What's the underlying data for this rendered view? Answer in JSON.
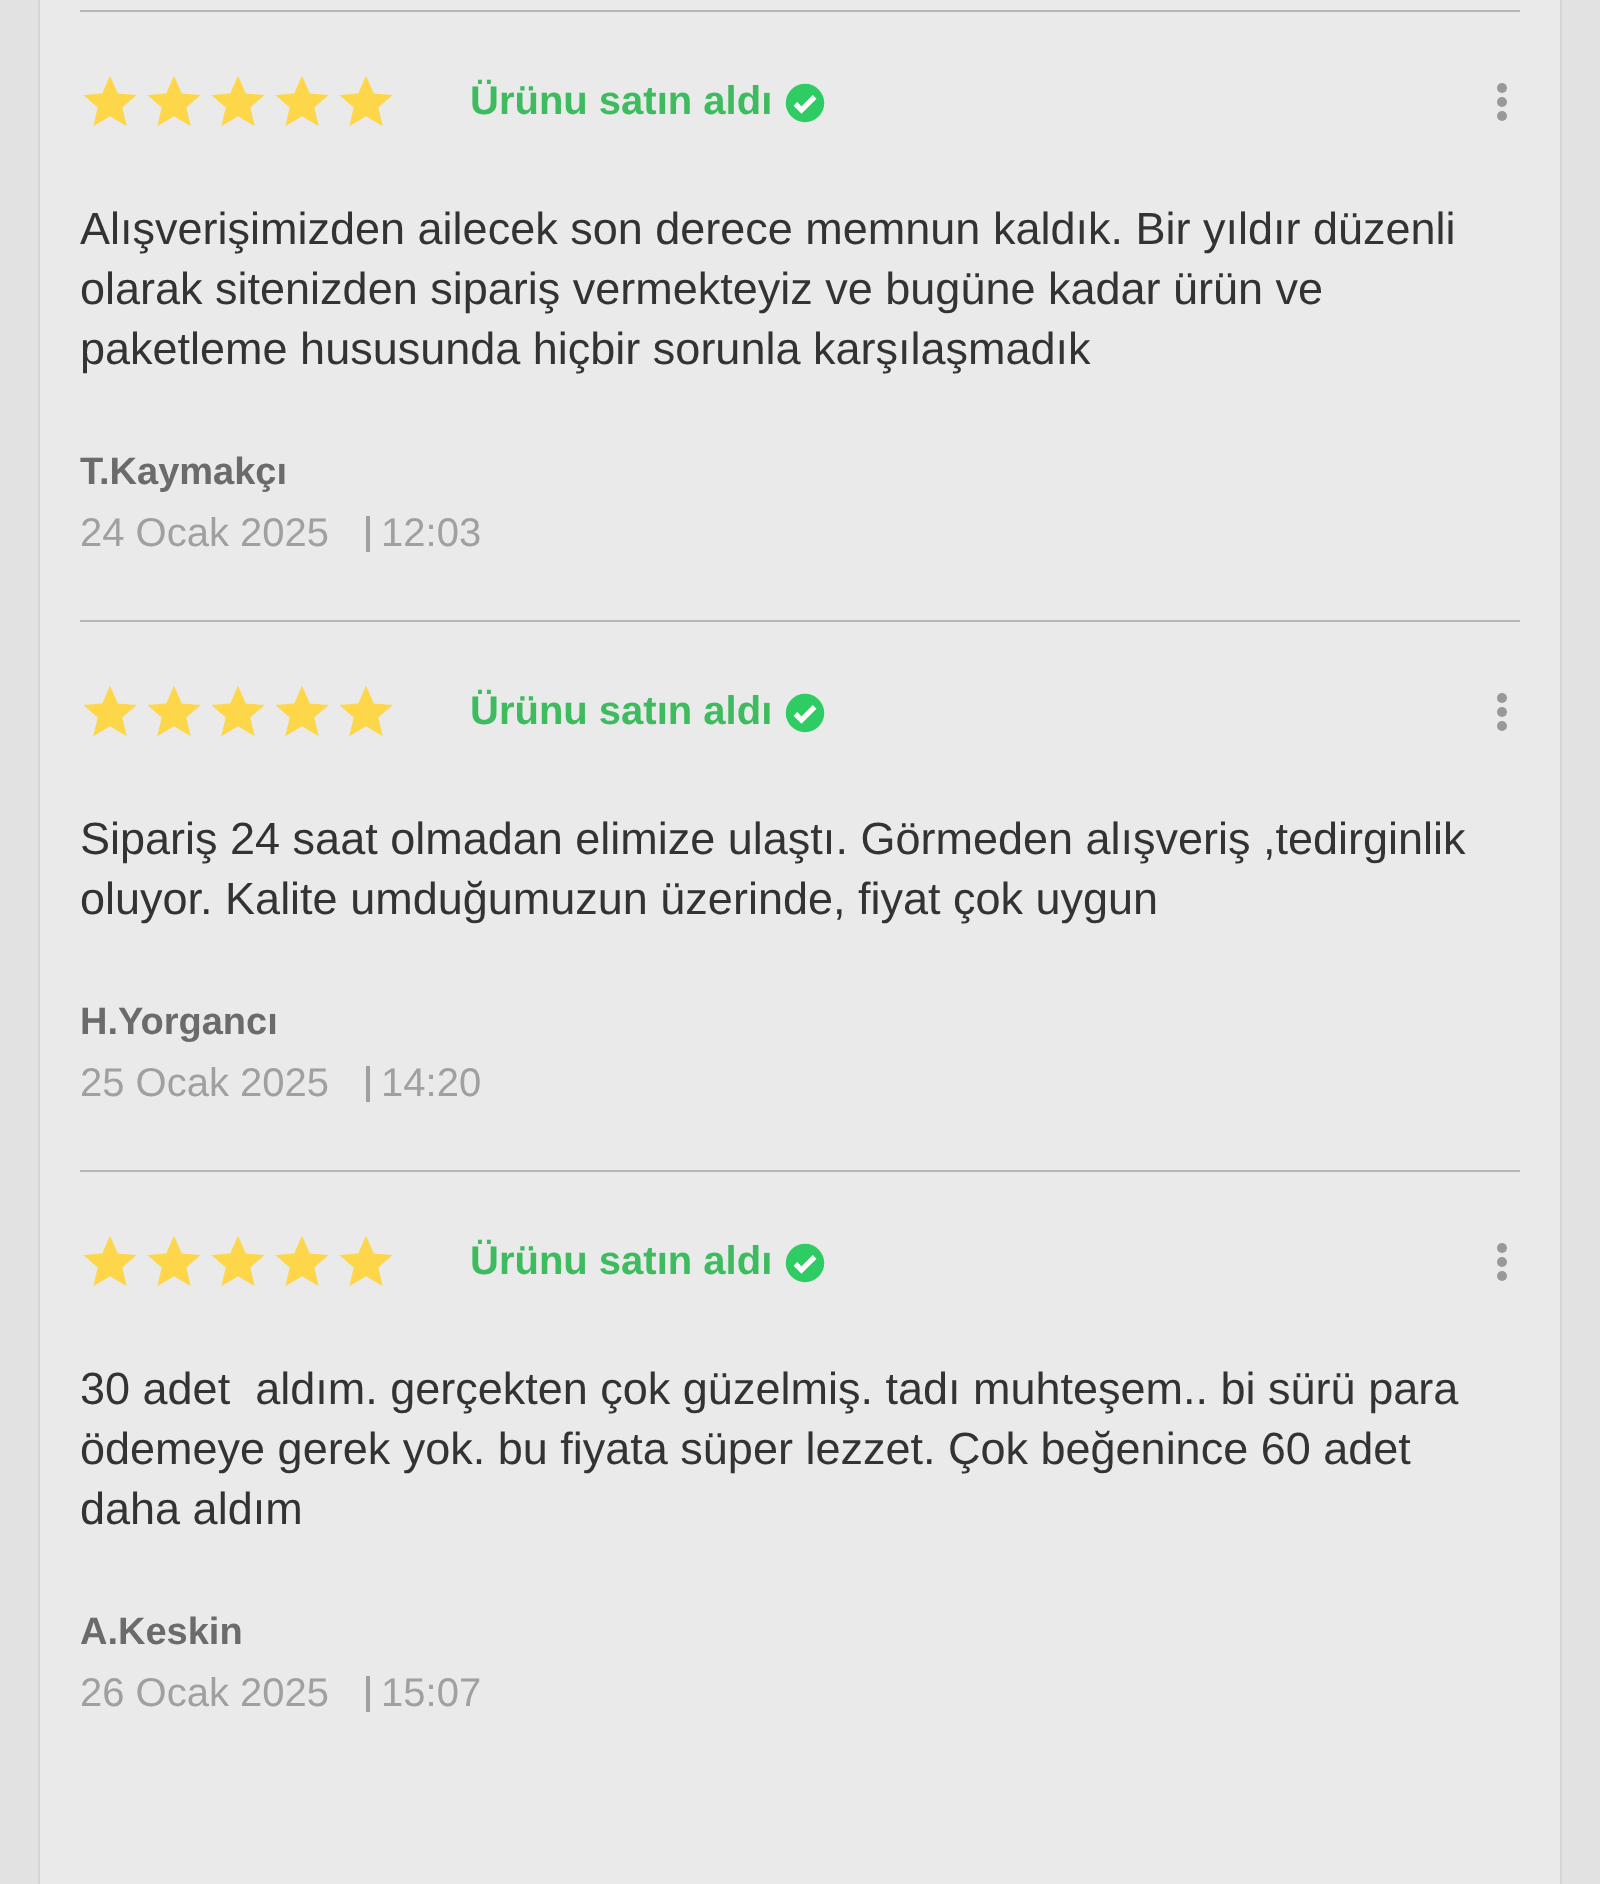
{
  "reviews": [
    {
      "stars": 5,
      "badge": "Ürünu satın aldı",
      "text": "Alışverişimizden ailecek son derece memnun kaldık. Bir yıldır düzenli olarak sitenizden sipariş vermekteyiz ve bugüne kadar ürün ve paketleme hususunda hiçbir sorunla karşılaşmadık",
      "author": "T.Kaymakçı",
      "date": "24 Ocak 2025",
      "time": "12:03"
    },
    {
      "stars": 5,
      "badge": "Ürünu satın aldı",
      "text": "Sipariş 24 saat olmadan elimize ulaştı. Görmeden alışveriş ,tedirginlik oluyor. Kalite umduğumuzun üzerinde, fiyat çok uygun",
      "author": "H.Yorgancı",
      "date": "25 Ocak 2025",
      "time": "14:20"
    },
    {
      "stars": 5,
      "badge": "Ürünu satın aldı",
      "text": "30 adet  aldım. gerçekten çok güzelmiş. tadı muhteşem.. bi sürü para ödemeye gerek yok. bu fiyata süper lezzet. Çok beğenince 60 adet daha aldım",
      "author": "A.Keskin",
      "date": "26 Ocak 2025",
      "time": "15:07"
    }
  ]
}
